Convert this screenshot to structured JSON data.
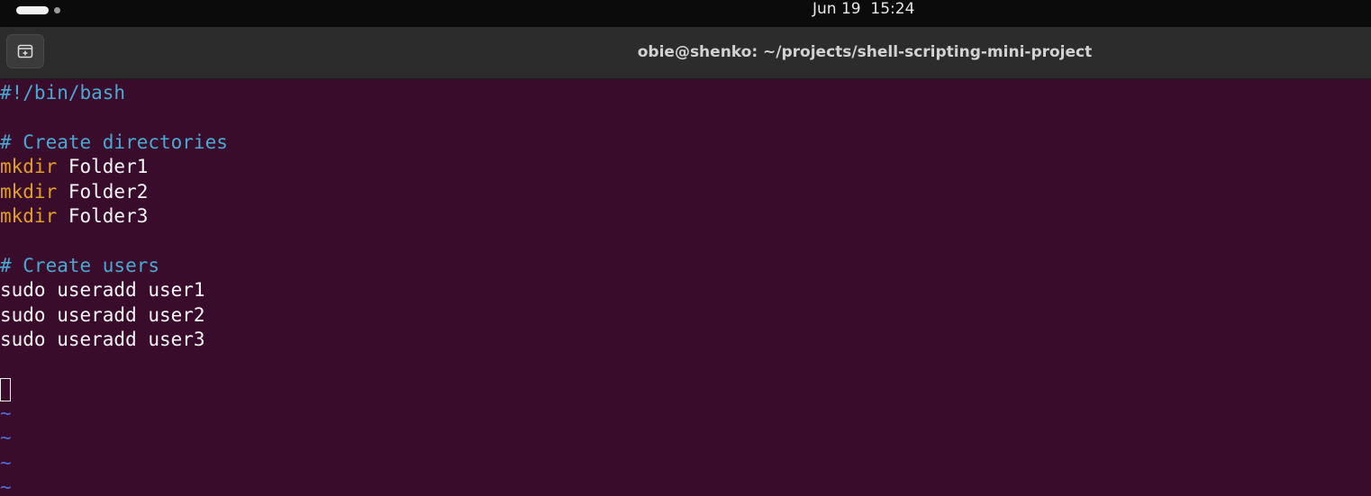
{
  "system_bar": {
    "clock": "Jun 19  15:24"
  },
  "window": {
    "title": "obie@shenko: ~/projects/shell-scripting-mini-project",
    "new_tab_icon": "new-tab-icon"
  },
  "editor": {
    "lines": {
      "shebang": "#!/bin/bash",
      "comment_dirs": "# Create directories",
      "mkdir1_cmd": "mkdir",
      "mkdir1_arg": " Folder1",
      "mkdir2_cmd": "mkdir",
      "mkdir2_arg": " Folder2",
      "mkdir3_cmd": "mkdir",
      "mkdir3_arg": " Folder3",
      "comment_users": "# Create users",
      "useradd1": "sudo useradd user1",
      "useradd2": "sudo useradd user2",
      "useradd3": "sudo useradd user3",
      "tilde": "~"
    },
    "colors": {
      "background": "#3a0c2b",
      "comment": "#4aa9d3",
      "keyword": "#e0a020",
      "text": "#f5f5f5",
      "tilde": "#4b6fd8"
    }
  }
}
